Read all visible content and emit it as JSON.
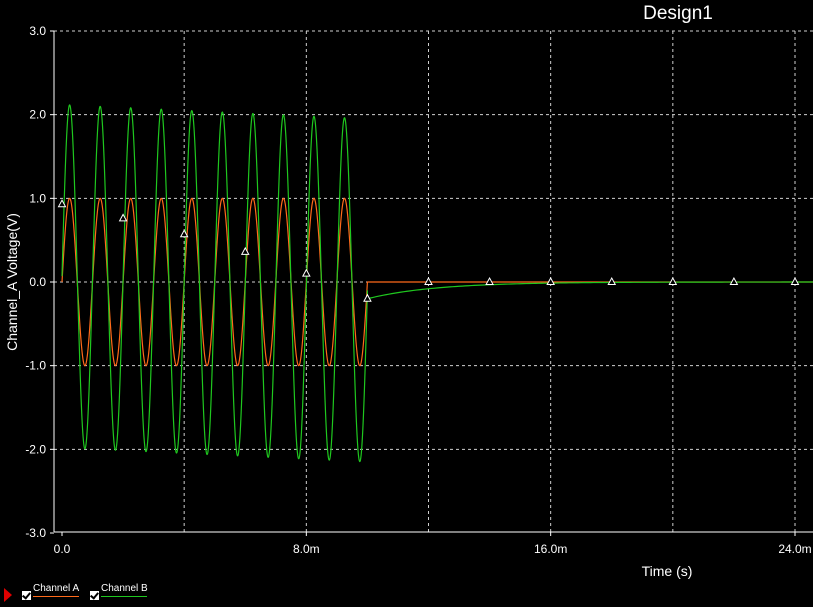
{
  "chart_data": {
    "type": "line",
    "title": "Design1",
    "xlabel": "Time (s)",
    "ylabel": "Channel_A Voltage(V)",
    "xlim": [
      -0.0002,
      0.0247
    ],
    "ylim": [
      -3.0,
      3.0
    ],
    "x_ticks": [
      {
        "value": 0.0,
        "label": "0.0"
      },
      {
        "value": 0.008,
        "label": "8.0m"
      },
      {
        "value": 0.016,
        "label": "16.0m"
      },
      {
        "value": 0.024,
        "label": "24.0m"
      }
    ],
    "y_ticks": [
      {
        "value": 3.0,
        "label": "3.0"
      },
      {
        "value": 2.0,
        "label": "2.0"
      },
      {
        "value": 1.0,
        "label": "1.0"
      },
      {
        "value": 0.0,
        "label": "0.0"
      },
      {
        "value": -1.0,
        "label": "-1.0"
      },
      {
        "value": -2.0,
        "label": "-2.0"
      },
      {
        "value": -3.0,
        "label": "-3.0"
      }
    ],
    "grid": true,
    "series": [
      {
        "name": "Channel A",
        "color": "#ff6a1a",
        "description": "square-ish sinusoid, amplitude 1 V, period 1 ms, from 0 to 10 ms, then 0 V",
        "amplitude": 1.0,
        "period": 0.001,
        "on_until": 0.01,
        "after_value": 0.0
      },
      {
        "name": "Channel B",
        "color": "#1fc81f",
        "description": "sinusoid period 1 ms, amplitude ~2.05 V with decaying DC offset, then exponential decay from -0.2 V to 0",
        "amplitude": 2.05,
        "period": 0.001,
        "on_until": 0.01,
        "offset_start": 0.07,
        "offset_end": -0.1,
        "tail_start": -0.2,
        "tail_tau": 0.0022,
        "markers": [
          [
            0.0,
            0.93
          ],
          [
            0.002,
            0.76
          ],
          [
            0.004,
            0.57
          ],
          [
            0.006,
            0.36
          ],
          [
            0.008,
            0.1
          ],
          [
            0.01,
            -0.2
          ],
          [
            0.012,
            0.0
          ],
          [
            0.014,
            0.0
          ],
          [
            0.016,
            0.0
          ],
          [
            0.018,
            0.0
          ],
          [
            0.02,
            0.0
          ],
          [
            0.022,
            0.0
          ],
          [
            0.024,
            0.0
          ]
        ]
      }
    ],
    "legend": "bottom-left"
  },
  "legend": {
    "a_label": "Channel A",
    "b_label": "Channel B",
    "a_color": "#ff6a1a",
    "b_color": "#1fc81f"
  }
}
